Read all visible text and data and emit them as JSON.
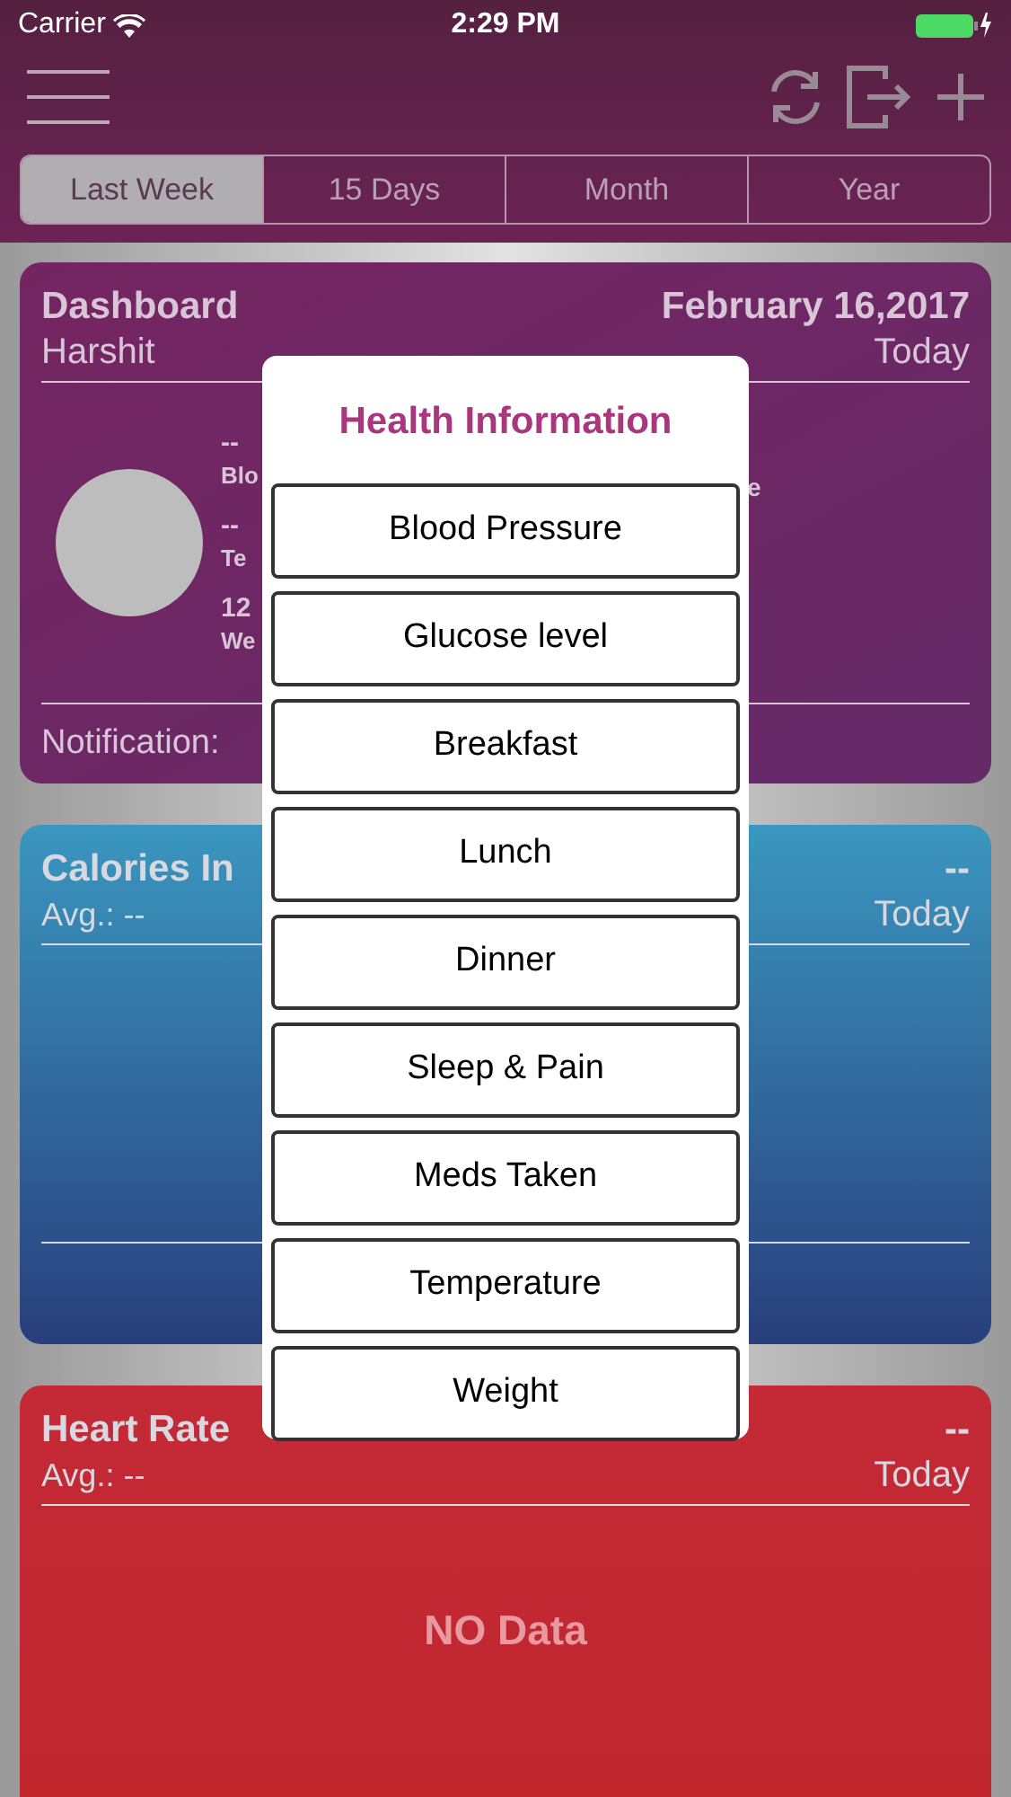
{
  "status_bar": {
    "carrier": "Carrier",
    "time": "2:29 PM"
  },
  "segments": [
    {
      "label": "Last Week",
      "selected": true
    },
    {
      "label": "15 Days",
      "selected": false
    },
    {
      "label": "Month",
      "selected": false
    },
    {
      "label": "Year",
      "selected": false
    }
  ],
  "dashboard": {
    "title": "Dashboard",
    "date": "February 16,2017",
    "user": "Harshit",
    "period": "Today",
    "stats": [
      {
        "value": "--",
        "label": "Blo"
      },
      {
        "value": "--",
        "label": "Te"
      },
      {
        "value": "12",
        "label": "We"
      }
    ],
    "right_fragment": "e",
    "notification": "Notification:"
  },
  "cards": [
    {
      "kind": "calories",
      "title": "Calories In",
      "value": "--",
      "average": "Avg.: --",
      "period": "Today"
    },
    {
      "kind": "heart",
      "title": "Heart Rate",
      "value": "--",
      "average": "Avg.: --",
      "period": "Today",
      "message": "NO Data"
    }
  ],
  "dialog": {
    "title": "Health Information",
    "options": [
      "Blood Pressure",
      "Glucose level",
      "Breakfast",
      "Lunch",
      "Dinner",
      "Sleep & Pain",
      "Meds Taken",
      "Temperature",
      "Weight"
    ]
  }
}
